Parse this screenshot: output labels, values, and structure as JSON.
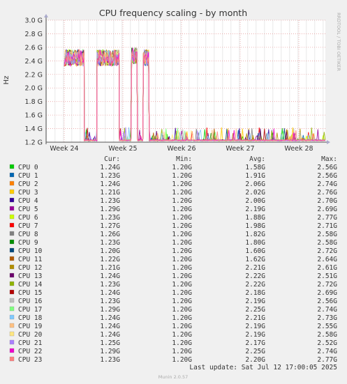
{
  "chart_data": {
    "type": "line",
    "title": "CPU frequency scaling - by month",
    "ylabel": "Hz",
    "side_label": "RRDTOOL / TOBI OETIKER",
    "footer_left": "Munin 2.0.57",
    "ylim": [
      1.2,
      3.0
    ],
    "y_ticks": [
      {
        "value": 3.0,
        "label": "3.0 G"
      },
      {
        "value": 2.8,
        "label": "2.8 G"
      },
      {
        "value": 2.6,
        "label": "2.6 G"
      },
      {
        "value": 2.4,
        "label": "2.4 G"
      },
      {
        "value": 2.2,
        "label": "2.2 G"
      },
      {
        "value": 2.0,
        "label": "2.0 G"
      },
      {
        "value": 1.8,
        "label": "1.8 G"
      },
      {
        "value": 1.6,
        "label": "1.6 G"
      },
      {
        "value": 1.4,
        "label": "1.4 G"
      },
      {
        "value": 1.2,
        "label": "1.2 G"
      }
    ],
    "x_ticks": [
      "Week 24",
      "Week 25",
      "Week 26",
      "Week 27",
      "Week 28"
    ],
    "grid": true,
    "segments": [
      {
        "x": [
          0.0,
          0.34
        ],
        "level": 2.42,
        "state": "busy"
      },
      {
        "x": [
          0.34,
          0.56
        ],
        "level": 1.22,
        "state": "idle"
      },
      {
        "x": [
          0.56,
          0.94
        ],
        "level": 2.42,
        "state": "busy"
      },
      {
        "x": [
          0.94,
          1.15
        ],
        "level": 1.22,
        "state": "idle"
      },
      {
        "x": [
          1.15,
          1.25
        ],
        "level": 2.45,
        "state": "busy"
      },
      {
        "x": [
          1.25,
          1.35
        ],
        "level": 1.22,
        "state": "idle"
      },
      {
        "x": [
          1.35,
          1.45
        ],
        "level": 2.42,
        "state": "busy"
      },
      {
        "x": [
          1.45,
          4.45
        ],
        "level": 1.22,
        "state": "idle"
      }
    ],
    "columns": [
      "Cur:",
      "Min:",
      "Avg:",
      "Max:"
    ],
    "series": [
      {
        "name": "CPU 0",
        "color": "#00cc00",
        "cur": "1.24G",
        "min": "1.20G",
        "avg": "1.58G",
        "max": "2.56G"
      },
      {
        "name": "CPU 1",
        "color": "#0066b3",
        "cur": "1.23G",
        "min": "1.20G",
        "avg": "1.91G",
        "max": "2.56G"
      },
      {
        "name": "CPU 2",
        "color": "#ff8000",
        "cur": "1.24G",
        "min": "1.20G",
        "avg": "2.06G",
        "max": "2.74G"
      },
      {
        "name": "CPU 3",
        "color": "#ffcc00",
        "cur": "1.21G",
        "min": "1.20G",
        "avg": "2.02G",
        "max": "2.76G"
      },
      {
        "name": "CPU 4",
        "color": "#330099",
        "cur": "1.23G",
        "min": "1.20G",
        "avg": "2.00G",
        "max": "2.70G"
      },
      {
        "name": "CPU 5",
        "color": "#990099",
        "cur": "1.29G",
        "min": "1.20G",
        "avg": "2.19G",
        "max": "2.69G"
      },
      {
        "name": "CPU 6",
        "color": "#ccff00",
        "cur": "1.23G",
        "min": "1.20G",
        "avg": "1.88G",
        "max": "2.77G"
      },
      {
        "name": "CPU 7",
        "color": "#ff0000",
        "cur": "1.27G",
        "min": "1.20G",
        "avg": "1.98G",
        "max": "2.71G"
      },
      {
        "name": "CPU 8",
        "color": "#808080",
        "cur": "1.26G",
        "min": "1.20G",
        "avg": "1.82G",
        "max": "2.58G"
      },
      {
        "name": "CPU 9",
        "color": "#008f00",
        "cur": "1.23G",
        "min": "1.20G",
        "avg": "1.80G",
        "max": "2.58G"
      },
      {
        "name": "CPU 10",
        "color": "#00487d",
        "cur": "1.20G",
        "min": "1.20G",
        "avg": "1.60G",
        "max": "2.72G"
      },
      {
        "name": "CPU 11",
        "color": "#b35a00",
        "cur": "1.22G",
        "min": "1.20G",
        "avg": "1.62G",
        "max": "2.64G"
      },
      {
        "name": "CPU 12",
        "color": "#b38f00",
        "cur": "1.21G",
        "min": "1.20G",
        "avg": "2.21G",
        "max": "2.61G"
      },
      {
        "name": "CPU 13",
        "color": "#6b006b",
        "cur": "1.24G",
        "min": "1.20G",
        "avg": "2.22G",
        "max": "2.51G"
      },
      {
        "name": "CPU 14",
        "color": "#8fb300",
        "cur": "1.23G",
        "min": "1.20G",
        "avg": "2.22G",
        "max": "2.72G"
      },
      {
        "name": "CPU 15",
        "color": "#b30000",
        "cur": "1.24G",
        "min": "1.20G",
        "avg": "2.18G",
        "max": "2.69G"
      },
      {
        "name": "CPU 16",
        "color": "#bebebe",
        "cur": "1.23G",
        "min": "1.20G",
        "avg": "2.19G",
        "max": "2.56G"
      },
      {
        "name": "CPU 17",
        "color": "#80ff80",
        "cur": "1.29G",
        "min": "1.20G",
        "avg": "2.25G",
        "max": "2.74G"
      },
      {
        "name": "CPU 18",
        "color": "#80c9ff",
        "cur": "1.24G",
        "min": "1.20G",
        "avg": "2.21G",
        "max": "2.73G"
      },
      {
        "name": "CPU 19",
        "color": "#ffc080",
        "cur": "1.24G",
        "min": "1.20G",
        "avg": "2.19G",
        "max": "2.55G"
      },
      {
        "name": "CPU 20",
        "color": "#ffe680",
        "cur": "1.24G",
        "min": "1.20G",
        "avg": "2.19G",
        "max": "2.58G"
      },
      {
        "name": "CPU 21",
        "color": "#aa80ff",
        "cur": "1.25G",
        "min": "1.20G",
        "avg": "2.17G",
        "max": "2.52G"
      },
      {
        "name": "CPU 22",
        "color": "#ee00cc",
        "cur": "1.29G",
        "min": "1.20G",
        "avg": "2.25G",
        "max": "2.74G"
      },
      {
        "name": "CPU 23",
        "color": "#ff8080",
        "cur": "1.23G",
        "min": "1.20G",
        "avg": "2.20G",
        "max": "2.77G"
      }
    ],
    "last_update": "Last update: Sat Jul 12 17:00:05 2025"
  }
}
